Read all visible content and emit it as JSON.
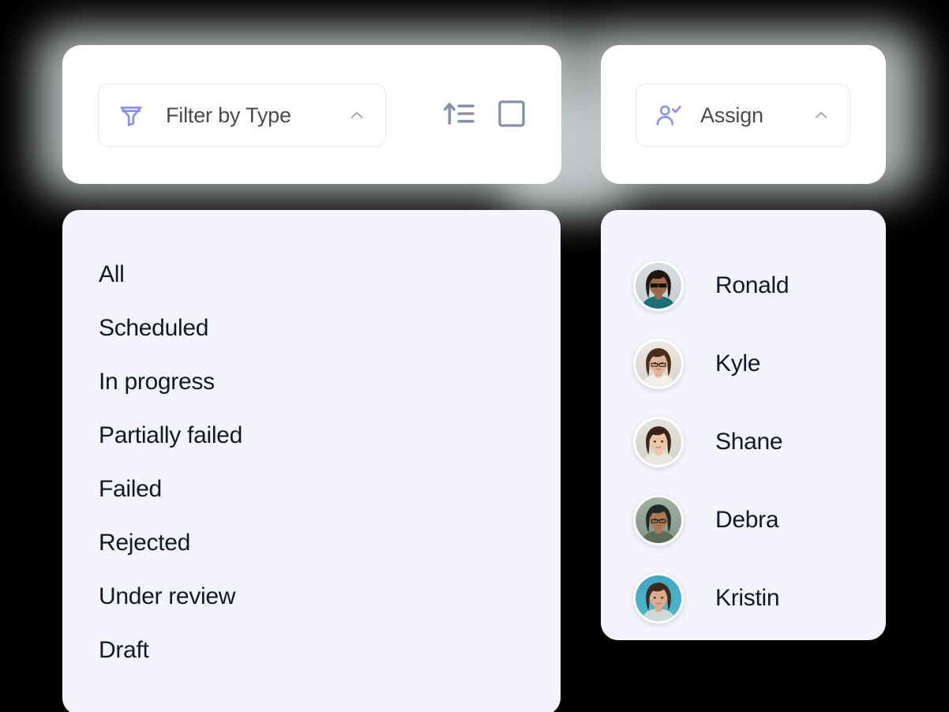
{
  "colors": {
    "background": "#000000",
    "card": "#ffffff",
    "panel": "#f4f4fd",
    "accent_periwinkle": "#8b90f7",
    "icon_slate": "#8691a8",
    "text_dark": "#111827",
    "text_muted": "#4b4b4f",
    "chevron": "#a0a4ad",
    "border": "#e7e9ee",
    "glow": "#c9cfd0"
  },
  "filter_toolbar": {
    "select": {
      "label": "Filter by Type",
      "icon": "funnel-filter-icon",
      "chevron": "chevron-up-icon",
      "expanded": true
    },
    "actions": [
      {
        "name": "sort-ascending-button",
        "icon": "sort-ascending-icon"
      },
      {
        "name": "select-all-checkbox-button",
        "icon": "square-outline-icon",
        "checked": false
      }
    ]
  },
  "assign_toolbar": {
    "select": {
      "label": "Assign",
      "icon": "user-check-icon",
      "chevron": "chevron-up-icon",
      "expanded": true
    }
  },
  "type_panel": {
    "options": [
      {
        "label": "All"
      },
      {
        "label": "Scheduled"
      },
      {
        "label": "In progress"
      },
      {
        "label": "Partially failed"
      },
      {
        "label": "Failed"
      },
      {
        "label": "Rejected"
      },
      {
        "label": "Under review"
      },
      {
        "label": "Draft"
      }
    ]
  },
  "assign_panel": {
    "assignees": [
      {
        "name": "Ronald",
        "avatar": "photo-person-curly-hair-sunglasses",
        "hair": "#20150f",
        "skin": "#9c6a4a",
        "bg_top": "#d7dee0",
        "bg_bottom": "#c3ccd0",
        "clothing": "#1d6f79"
      },
      {
        "name": "Kyle",
        "avatar": "photo-person-long-hair-glasses",
        "hair": "#4a2c1c",
        "skin": "#e0b79b",
        "bg_top": "#efe9e4",
        "bg_bottom": "#d9d2cc",
        "clothing": "#f2efec"
      },
      {
        "name": "Shane",
        "avatar": "photo-person-bob-haircut",
        "hair": "#3a2317",
        "skin": "#ecc6a8",
        "bg_top": "#e7e3dc",
        "bg_bottom": "#cfd3c8",
        "clothing": "#e9e6de"
      },
      {
        "name": "Debra",
        "avatar": "photo-person-bun-glasses",
        "hair": "#20282a",
        "skin": "#a87a58",
        "bg_top": "#9fb2a2",
        "bg_bottom": "#7e9585",
        "clothing": "#5c6d5a"
      },
      {
        "name": "Kristin",
        "avatar": "photo-person-wavy-hair",
        "hair": "#3c2a1e",
        "skin": "#dcab8b",
        "bg_top": "#3fa8c4",
        "bg_bottom": "#53b7cd",
        "clothing": "#cfd8d6"
      }
    ]
  }
}
